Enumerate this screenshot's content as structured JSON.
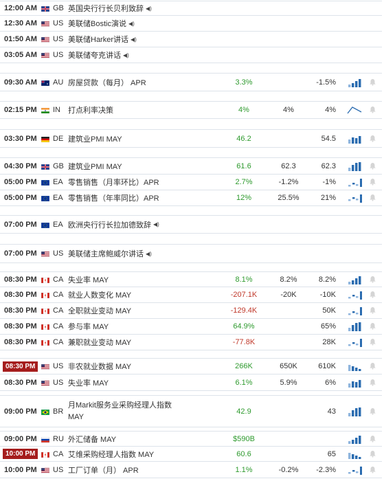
{
  "colors": {
    "actual_positive": "#2e9a2e",
    "actual_negative": "#c0392b",
    "high_impact_time_bg": "#a51d1d",
    "sparkline": "#2b6cb0",
    "sparkline_light": "#90b6de",
    "bell": "#d5d5d5",
    "row_border": "#dde3ea"
  },
  "rows": [
    {
      "time": "12:00 AM",
      "country": "GB",
      "flag": "gb-flag",
      "event": "英国央行行长贝利致辞",
      "speech": true,
      "actual": "",
      "forecast": "",
      "previous": "",
      "spark": "",
      "bell": false
    },
    {
      "time": "12:30 AM",
      "country": "US",
      "flag": "us-flag",
      "event": "美联储Bostic演说",
      "speech": true,
      "actual": "",
      "forecast": "",
      "previous": "",
      "spark": "",
      "bell": false
    },
    {
      "time": "01:50 AM",
      "country": "US",
      "flag": "us-flag",
      "event": "美联储Harker讲话",
      "speech": true,
      "actual": "",
      "forecast": "",
      "previous": "",
      "spark": "",
      "bell": false
    },
    {
      "time": "03:05 AM",
      "country": "US",
      "flag": "us-flag",
      "event": "美联储夸克讲话",
      "speech": true,
      "actual": "",
      "forecast": "",
      "previous": "",
      "spark": "",
      "bell": false
    },
    {
      "time": "09:30 AM",
      "country": "AU",
      "flag": "au-flag",
      "event": "房屋贷款（每月） APR",
      "speech": false,
      "actual": "3.3%",
      "actual_neg": false,
      "forecast": "",
      "previous": "-1.5%",
      "spark": "bars",
      "bell": true
    },
    {
      "time": "02:15 PM",
      "country": "IN",
      "flag": "in-flag",
      "event": "打点利率决策",
      "speech": false,
      "actual": "4%",
      "actual_neg": false,
      "forecast": "4%",
      "previous": "4%",
      "spark": "line",
      "bell": true
    },
    {
      "time": "03:30 PM",
      "country": "DE",
      "flag": "de-flag",
      "event": "建筑业PMI MAY",
      "speech": false,
      "actual": "46.2",
      "actual_neg": false,
      "forecast": "",
      "previous": "54.5",
      "spark": "bars",
      "bell": true
    },
    {
      "time": "04:30 PM",
      "country": "GB",
      "flag": "gb-flag",
      "event": "建筑业PMI MAY",
      "speech": false,
      "actual": "61.6",
      "actual_neg": false,
      "forecast": "62.3",
      "previous": "62.3",
      "spark": "bars",
      "bell": true
    },
    {
      "time": "05:00 PM",
      "country": "EA",
      "flag": "eu-flag",
      "event": "零售销售（月率环比）APR",
      "speech": false,
      "actual": "2.7%",
      "actual_neg": false,
      "forecast": "-1.2%",
      "previous": "-1%",
      "spark": "dots",
      "bell": true
    },
    {
      "time": "05:00 PM",
      "country": "EA",
      "flag": "eu-flag",
      "event": "零售销售（年率同比）APR",
      "speech": false,
      "actual": "12%",
      "actual_neg": false,
      "forecast": "25.5%",
      "previous": "21%",
      "spark": "dots",
      "bell": true
    },
    {
      "time": "07:00 PM",
      "country": "EA",
      "flag": "eu-flag",
      "event": "欧洲央行行长拉加德致辞",
      "speech": true,
      "actual": "",
      "forecast": "",
      "previous": "",
      "spark": "",
      "bell": false
    },
    {
      "time": "07:00 PM",
      "country": "US",
      "flag": "us-flag",
      "event": "美联储主席鲍威尔讲话",
      "speech": true,
      "actual": "",
      "forecast": "",
      "previous": "",
      "spark": "",
      "bell": false
    },
    {
      "time": "08:30 PM",
      "country": "CA",
      "flag": "ca-flag",
      "event": "失业率 MAY",
      "speech": false,
      "actual": "8.1%",
      "actual_neg": false,
      "forecast": "8.2%",
      "previous": "8.2%",
      "spark": "bars",
      "bell": true
    },
    {
      "time": "08:30 PM",
      "country": "CA",
      "flag": "ca-flag",
      "event": "就业人数变化 MAY",
      "speech": false,
      "actual": "-207.1K",
      "actual_neg": true,
      "forecast": "-20K",
      "previous": "-10K",
      "spark": "dots",
      "bell": true
    },
    {
      "time": "08:30 PM",
      "country": "CA",
      "flag": "ca-flag",
      "event": "全职就业变动 MAY",
      "speech": false,
      "actual": "-129.4K",
      "actual_neg": true,
      "forecast": "",
      "previous": "50K",
      "spark": "dots",
      "bell": true
    },
    {
      "time": "08:30 PM",
      "country": "CA",
      "flag": "ca-flag",
      "event": "参与率 MAY",
      "speech": false,
      "actual": "64.9%",
      "actual_neg": false,
      "forecast": "",
      "previous": "65%",
      "spark": "bars",
      "bell": true
    },
    {
      "time": "08:30 PM",
      "country": "CA",
      "flag": "ca-flag",
      "event": "兼职就业变动 MAY",
      "speech": false,
      "actual": "-77.8K",
      "actual_neg": true,
      "forecast": "",
      "previous": "28K",
      "spark": "dots",
      "bell": true
    },
    {
      "time": "08:30 PM",
      "time_highlight": true,
      "country": "US",
      "flag": "us-flag",
      "event": "非农就业数据 MAY",
      "speech": false,
      "actual": "266K",
      "actual_neg": false,
      "forecast": "650K",
      "previous": "610K",
      "spark": "bars",
      "bell": true
    },
    {
      "time": "08:30 PM",
      "country": "US",
      "flag": "us-flag",
      "event": "失业率 MAY",
      "speech": false,
      "actual": "6.1%",
      "actual_neg": false,
      "forecast": "5.9%",
      "previous": "6%",
      "spark": "bars",
      "bell": true
    },
    {
      "time": "09:00 PM",
      "country": "BR",
      "flag": "br-flag",
      "event": "月Markit服务业采购经理人指数 MAY",
      "speech": false,
      "actual": "42.9",
      "actual_neg": false,
      "forecast": "",
      "previous": "43",
      "spark": "bars",
      "bell": true
    },
    {
      "time": "09:00 PM",
      "country": "RU",
      "flag": "ru-flag",
      "event": "外汇储备 MAY",
      "speech": false,
      "actual": "$590B",
      "actual_neg": false,
      "forecast": "",
      "previous": "",
      "spark": "bars",
      "bell": true
    },
    {
      "time": "10:00 PM",
      "time_highlight": true,
      "country": "CA",
      "flag": "ca-flag",
      "event": "艾维采购经理人指数 MAY",
      "speech": false,
      "actual": "60.6",
      "actual_neg": false,
      "forecast": "",
      "previous": "65",
      "spark": "bars",
      "bell": true
    },
    {
      "time": "10:00 PM",
      "country": "US",
      "flag": "us-flag",
      "event": "工厂订单（月） APR",
      "speech": false,
      "actual": "1.1%",
      "actual_neg": false,
      "forecast": "-0.2%",
      "previous": "-2.3%",
      "spark": "dots",
      "bell": true
    }
  ]
}
